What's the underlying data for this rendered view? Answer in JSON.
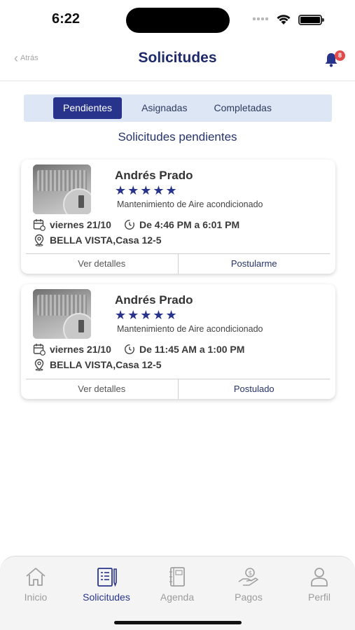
{
  "status_bar": {
    "time": "6:22"
  },
  "header": {
    "back_label": "Atrás",
    "title": "Solicitudes",
    "notification_count": "8"
  },
  "tabs": [
    {
      "label": "Pendientes"
    },
    {
      "label": "Asignadas"
    },
    {
      "label": "Completadas"
    }
  ],
  "section_title": "Solicitudes pendientes",
  "cards": [
    {
      "name": "Andrés Prado",
      "rating": "★★★★★",
      "service": "Mantenimiento de Aire acondicionado",
      "date": "viernes 21/10",
      "time_range": "De 4:46 PM a 6:01 PM",
      "address": "BELLA VISTA,Casa 12-5",
      "details_label": "Ver detalles",
      "action_label": "Postularme"
    },
    {
      "name": "Andrés Prado",
      "rating": "★★★★★",
      "service": "Mantenimiento de Aire acondicionado",
      "date": "viernes 21/10",
      "time_range": "De 11:45 AM a 1:00 PM",
      "address": "BELLA VISTA,Casa 12-5",
      "details_label": "Ver detalles",
      "action_label": "Postulado"
    }
  ],
  "bottom_nav": [
    {
      "label": "Inicio",
      "icon": "home-icon"
    },
    {
      "label": "Solicitudes",
      "icon": "clipboard-icon"
    },
    {
      "label": "Agenda",
      "icon": "notebook-icon"
    },
    {
      "label": "Pagos",
      "icon": "payment-hand-icon"
    },
    {
      "label": "Perfil",
      "icon": "user-icon"
    }
  ],
  "colors": {
    "primary": "#28348c",
    "title": "#1f2a6b",
    "tabs_bg": "#dde6f5",
    "badge": "#e24b4b"
  }
}
